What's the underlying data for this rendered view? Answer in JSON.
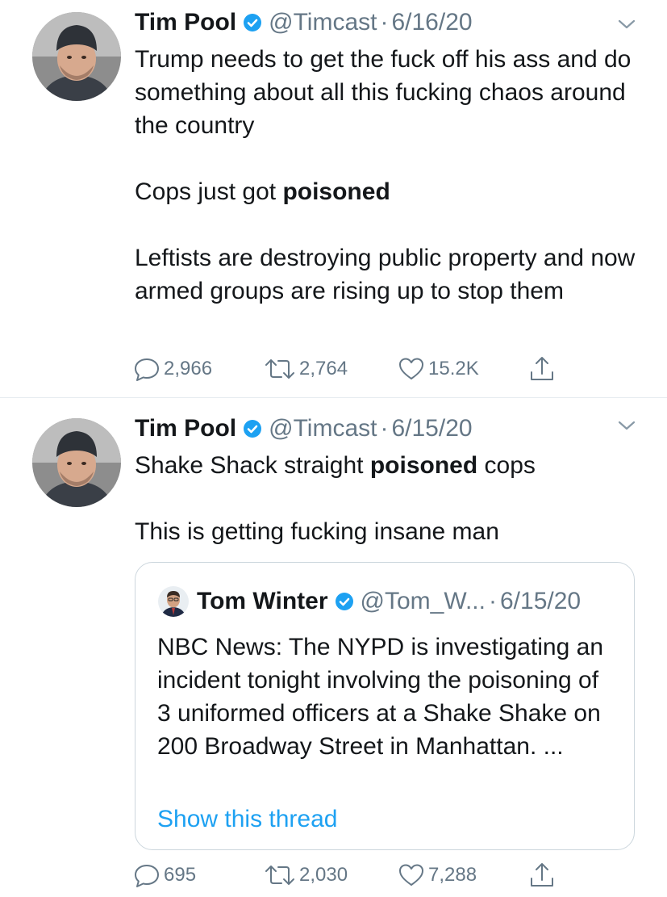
{
  "tweets": [
    {
      "author": {
        "name": "Tim Pool",
        "handle": "@Timcast"
      },
      "separator": "·",
      "date": "6/16/20",
      "body": {
        "line1": "Trump needs to get the fuck off his ass and do something about all this fucking chaos around the country",
        "line2_pre": "Cops just got ",
        "line2_bold": "poisoned",
        "line3": "Leftists are destroying public property and now armed groups are rising up to stop them"
      },
      "stats": {
        "replies": "2,966",
        "retweets": "2,764",
        "likes": "15.2K"
      }
    },
    {
      "author": {
        "name": "Tim Pool",
        "handle": "@Timcast"
      },
      "separator": "·",
      "date": "6/15/20",
      "body": {
        "line1_pre": "Shake Shack straight ",
        "line1_bold": "poisoned",
        "line1_post": " cops",
        "line2": "This is getting fucking insane man"
      },
      "quote": {
        "author": {
          "name": "Tom Winter",
          "handle": "@Tom_W..."
        },
        "separator": "·",
        "date": "6/15/20",
        "text": "NBC News: The NYPD is investigating an incident tonight involving the poisoning of 3 uniformed officers at a Shake Shake on 200 Broadway Street in Manhattan. ...",
        "show_thread": "Show this thread"
      },
      "stats": {
        "replies": "695",
        "retweets": "2,030",
        "likes": "7,288"
      }
    }
  ],
  "colors": {
    "text": "#14171a",
    "secondary": "#657786",
    "accent": "#1da1f2",
    "border": "#ccd6dd",
    "divider": "#e6ecf0"
  },
  "icons": {
    "verified": "verified-badge-icon",
    "caret": "chevron-down-icon",
    "reply": "reply-icon",
    "retweet": "retweet-icon",
    "like": "heart-icon",
    "share": "share-icon"
  }
}
